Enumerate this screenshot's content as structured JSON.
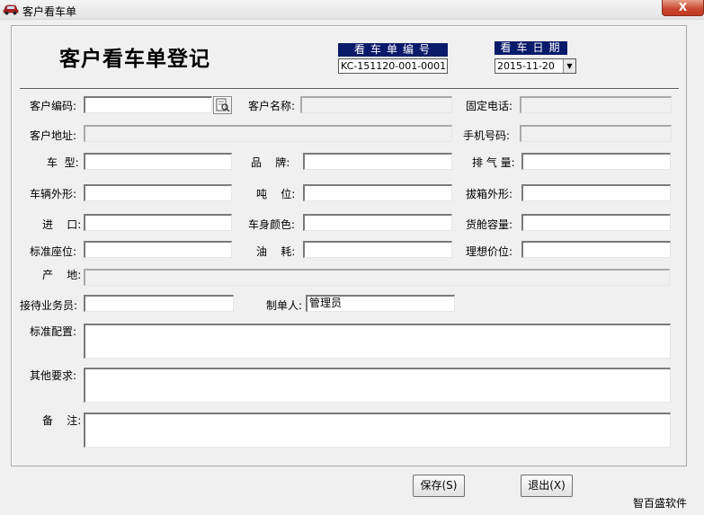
{
  "window": {
    "title": "客户看车单",
    "close_label": "X",
    "icon": "car-icon"
  },
  "header": {
    "heading": "客户看车单登记",
    "order_no_label": "看车单编号",
    "order_no_value": "KC-151120-001-0001",
    "date_label": "看车日期",
    "date_value": "2015-11-20"
  },
  "labels": {
    "customer_code": "客户编码:",
    "customer_name": "客户名称:",
    "phone": "固定电话:",
    "address": "客户地址:",
    "mobile": "手机号码:",
    "car_model": "车  型:",
    "brand": "品    牌:",
    "displacement": "排 气 量:",
    "body_shape": "车辆外形:",
    "tonnage": "吨    位:",
    "gearbox_shape": "拔箱外形:",
    "import": "进    口:",
    "body_color": "车身颜色:",
    "cargo_capacity": "货舱容量:",
    "seats": "标准座位:",
    "fuel": "油    耗:",
    "ideal_price": "理想价位:",
    "origin": "产    地:",
    "salesperson": "接待业务员:",
    "creator": "制单人:",
    "standard_config": "标准配置:",
    "other_requirements": "其他要求:",
    "remarks": "备    注:"
  },
  "values": {
    "creator": "管理员"
  },
  "buttons": {
    "save": "保存(S)",
    "exit": "退出(X)",
    "lookup_icon": "search-icon"
  },
  "footer": {
    "brand": "智百盛软件"
  }
}
